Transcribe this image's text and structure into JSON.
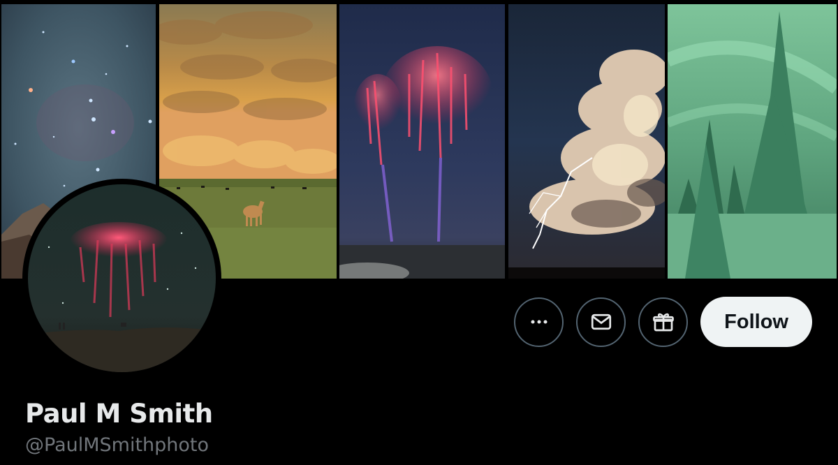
{
  "profile": {
    "display_name": "Paul M Smith",
    "handle": "@PaulMSmithphoto"
  },
  "banner": {
    "panels": [
      {
        "subject": "starry night sky"
      },
      {
        "subject": "mammatus clouds over pasture with horse"
      },
      {
        "subject": "red sprites lightning"
      },
      {
        "subject": "lightning storm cloud"
      },
      {
        "subject": "aurora over snowy trees"
      }
    ]
  },
  "avatar": {
    "subject": "red sprite over horizon"
  },
  "actions": {
    "more_icon": "more-horizontal-icon",
    "message_icon": "envelope-icon",
    "subscribe_icon": "gift-icon",
    "follow_label": "Follow"
  },
  "colors": {
    "background": "#000000",
    "text_primary": "#e7e9ea",
    "text_secondary": "#71767b",
    "button_border": "#536471",
    "follow_bg": "#eff3f4",
    "follow_text": "#0f1419"
  }
}
